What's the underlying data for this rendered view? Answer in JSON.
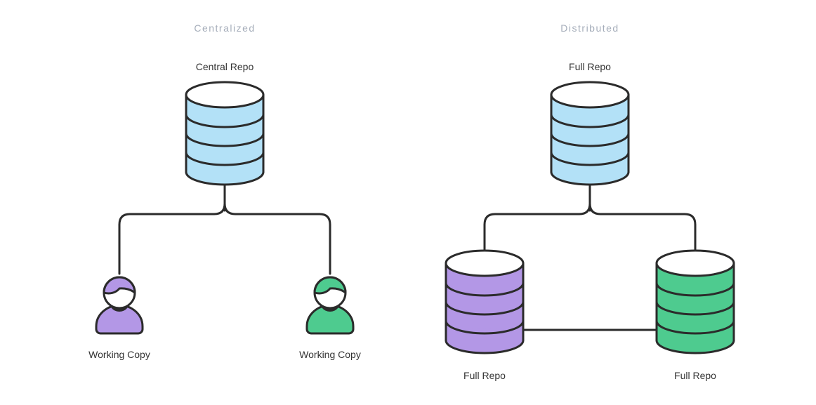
{
  "left": {
    "title": "Centralized",
    "top_label": "Central Repo",
    "bottom_left_label": "Working Copy",
    "bottom_right_label": "Working Copy"
  },
  "right": {
    "title": "Distributed",
    "top_label": "Full Repo",
    "bottom_left_label": "Full Repo",
    "bottom_right_label": "Full Repo"
  },
  "colors": {
    "blue": "#b3e1f7",
    "purple": "#b397e6",
    "green": "#4ecb8f",
    "stroke": "#2b2b2b",
    "title_gray": "#a5adba",
    "label_dark": "#333333"
  }
}
